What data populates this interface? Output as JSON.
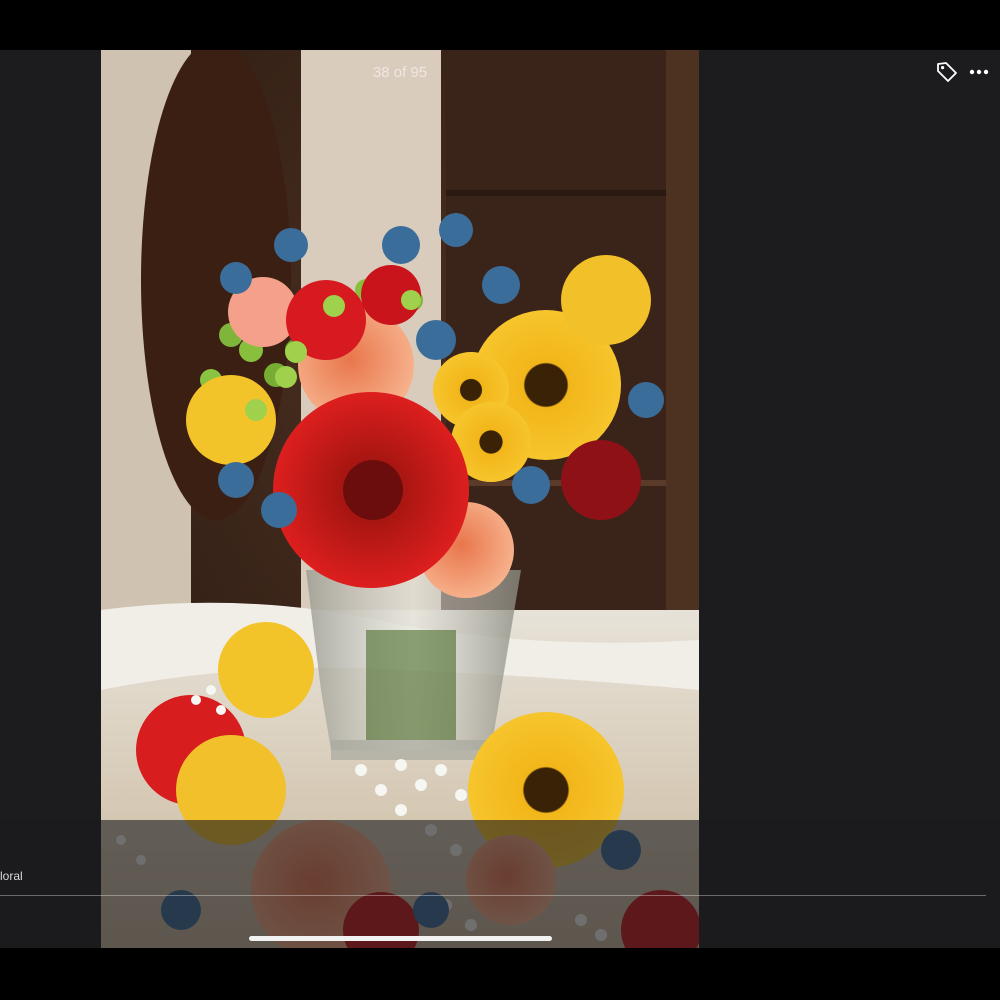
{
  "viewer": {
    "counter": "38 of 95",
    "caption": "loral",
    "toolbar": {
      "tag_icon": "tag-icon",
      "more_icon": "more-icon"
    }
  },
  "photo": {
    "subject": "flower-bouquet-in-glass-vase",
    "colors": {
      "background_wood": "#3a2418",
      "red_gerbera": "#c8141a",
      "sunflower": "#f0b419",
      "rose_peach": "#f0986a",
      "thistle_blue": "#3a6d9a"
    }
  }
}
